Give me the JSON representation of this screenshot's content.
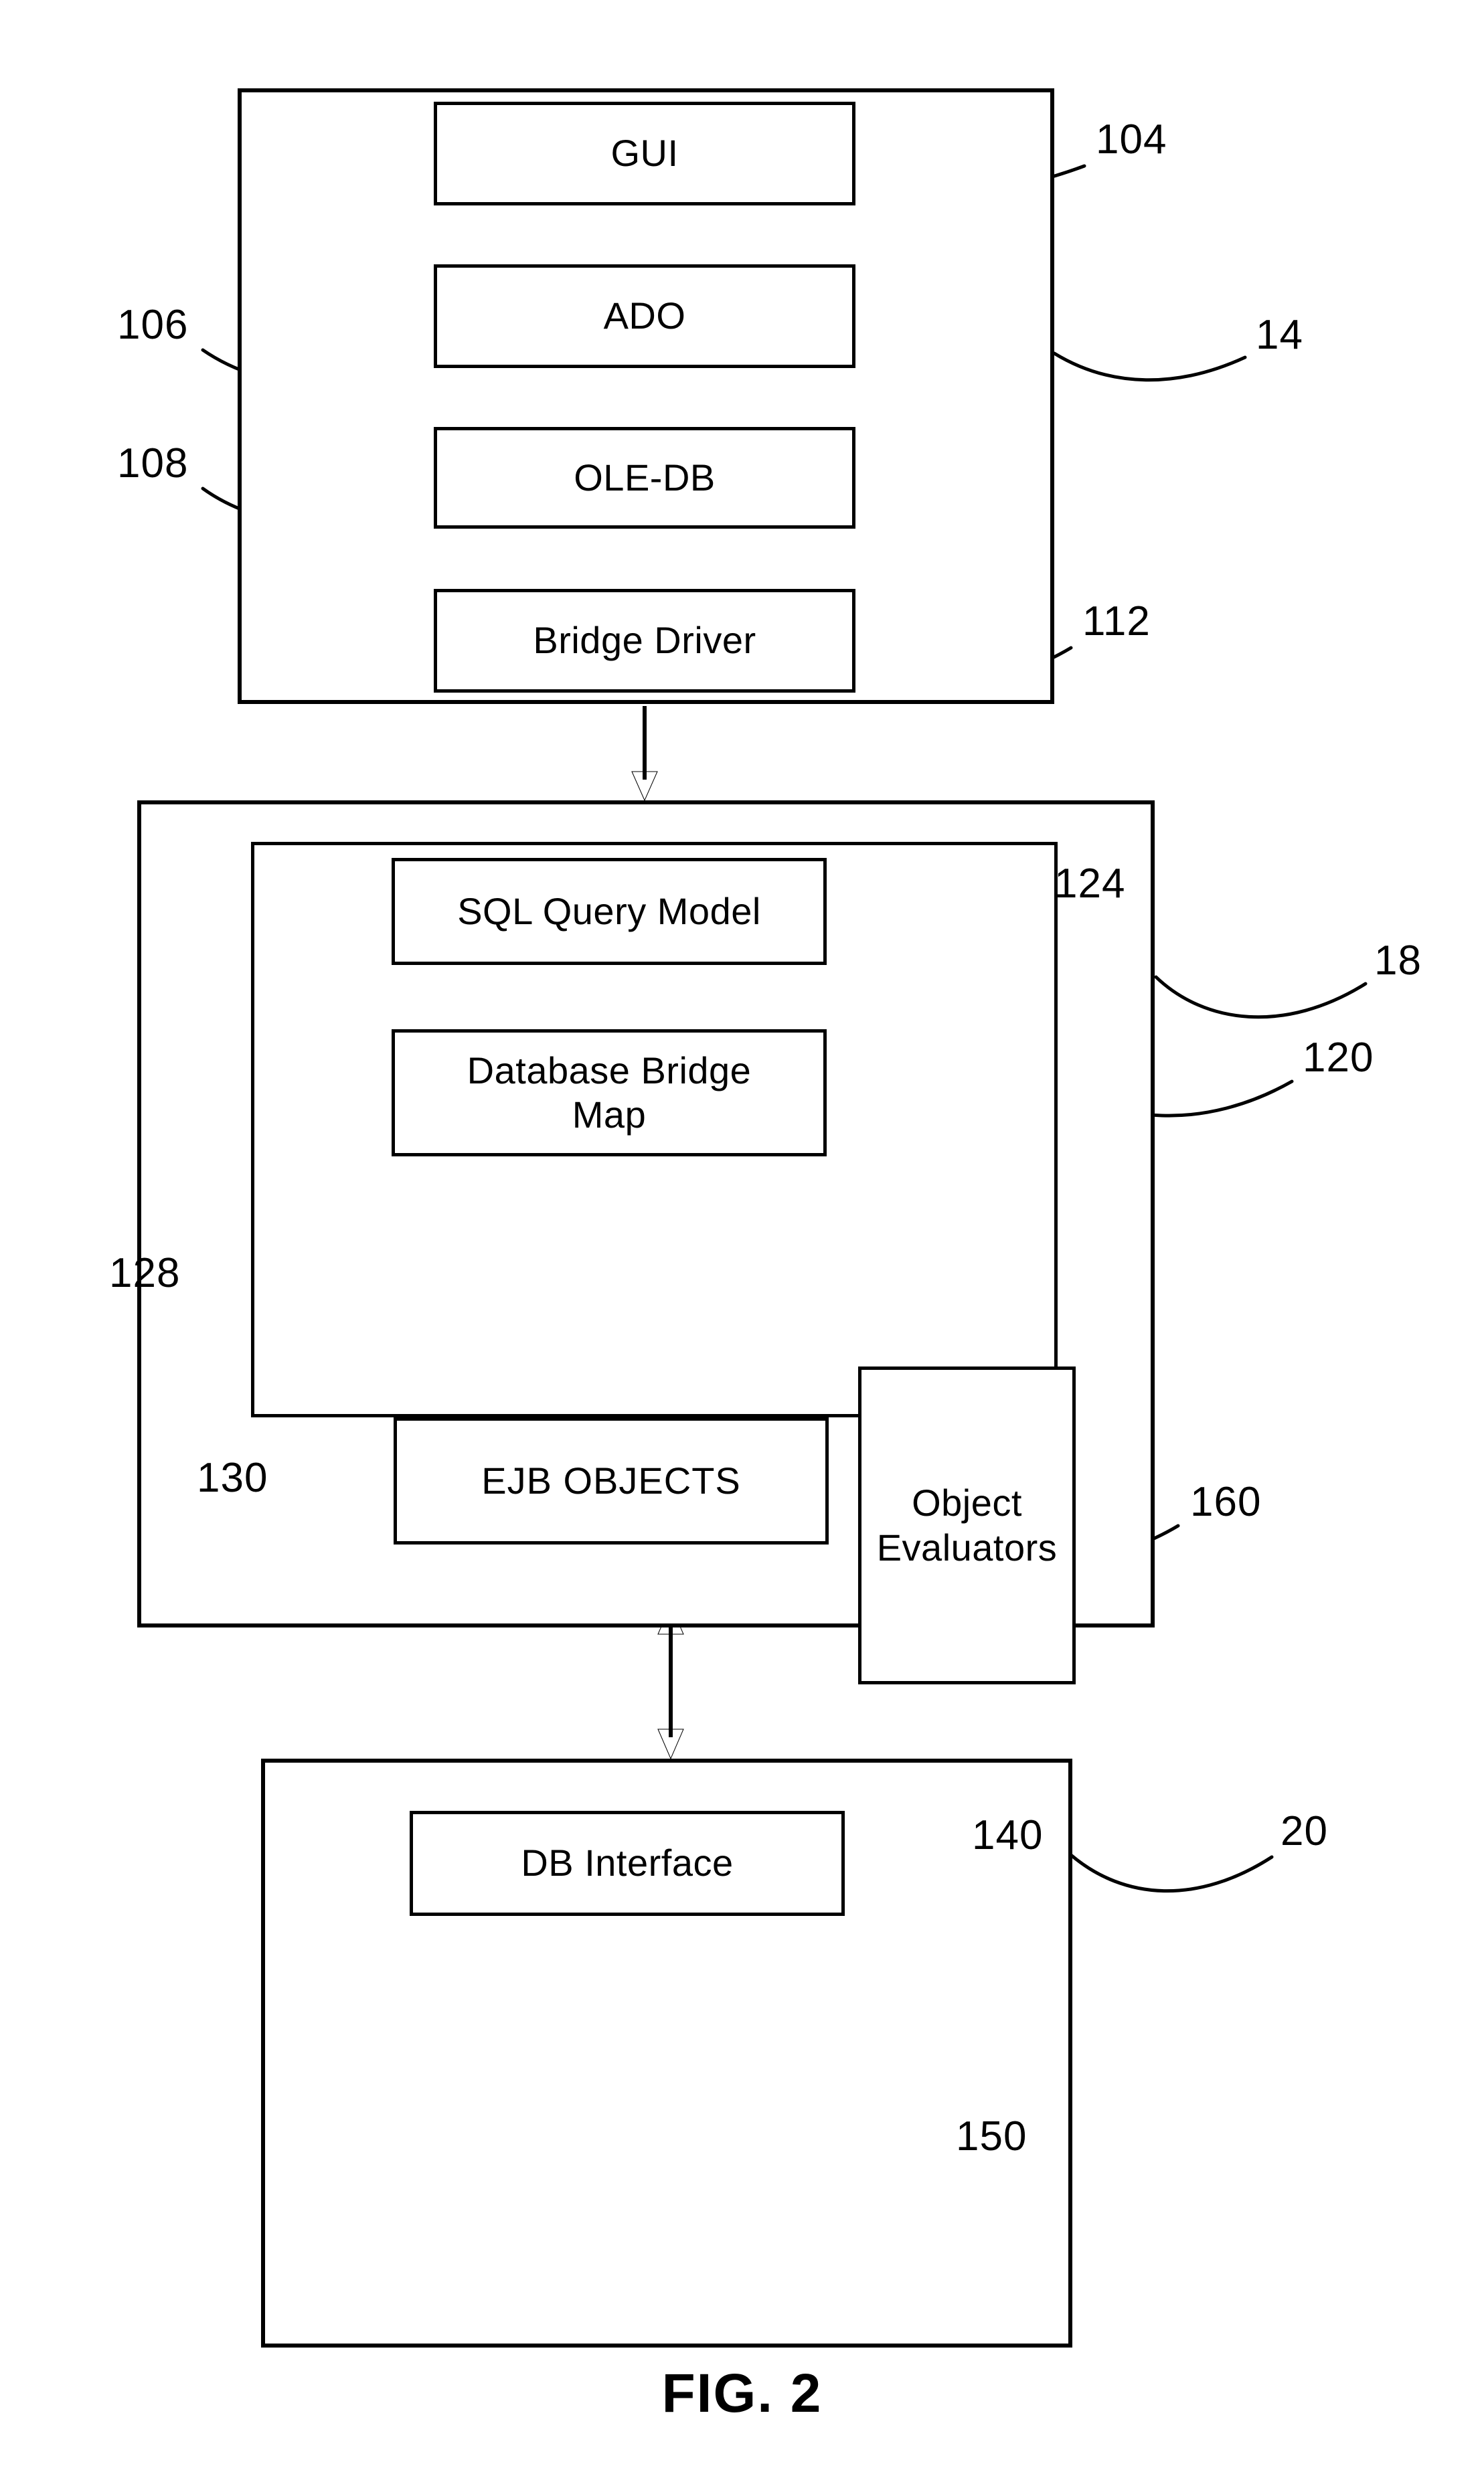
{
  "figure": {
    "caption": "FIG. 2",
    "type": "patent-block-diagram"
  },
  "tiers": [
    {
      "id": "client-tier",
      "ref": "14",
      "components": [
        {
          "id": "gui",
          "label": "GUI",
          "ref": "104"
        },
        {
          "id": "ado",
          "label": "ADO",
          "ref": "106"
        },
        {
          "id": "ole-db",
          "label": "OLE-DB",
          "ref": "108"
        },
        {
          "id": "bridge-driver",
          "label": "Bridge Driver",
          "ref": "112"
        }
      ]
    },
    {
      "id": "middle-tier",
      "ref": "18",
      "inner_frame_ref": "120",
      "components": [
        {
          "id": "sql-query-model",
          "label": "SQL Query Model",
          "ref": "124"
        },
        {
          "id": "database-bridge-map",
          "label": "Database Bridge\nMap",
          "ref": "128"
        },
        {
          "id": "ejb-objects",
          "label": "EJB OBJECTS",
          "ref": "130"
        },
        {
          "id": "object-evaluators",
          "label": "Object\nEvaluators",
          "ref": "160"
        }
      ]
    },
    {
      "id": "database-tier",
      "ref": "20",
      "components": [
        {
          "id": "db-interface",
          "label": "DB Interface",
          "ref": "140"
        },
        {
          "id": "database-cylinder",
          "label": "",
          "ref": "150"
        }
      ]
    }
  ],
  "connectors": [
    {
      "id": "gui-to-ado",
      "from": "gui",
      "to": "ado",
      "direction": "down"
    },
    {
      "id": "ado-to-oledb",
      "from": "ado",
      "to": "ole-db",
      "direction": "down"
    },
    {
      "id": "oledb-to-bridge-driver",
      "from": "ole-db",
      "to": "bridge-driver",
      "direction": "down"
    },
    {
      "id": "client-to-middle-tier",
      "from": "client-tier",
      "to": "middle-tier",
      "direction": "down"
    },
    {
      "id": "middle-to-database-tier",
      "from": "middle-tier",
      "to": "database-tier",
      "direction": "bidirectional"
    }
  ]
}
